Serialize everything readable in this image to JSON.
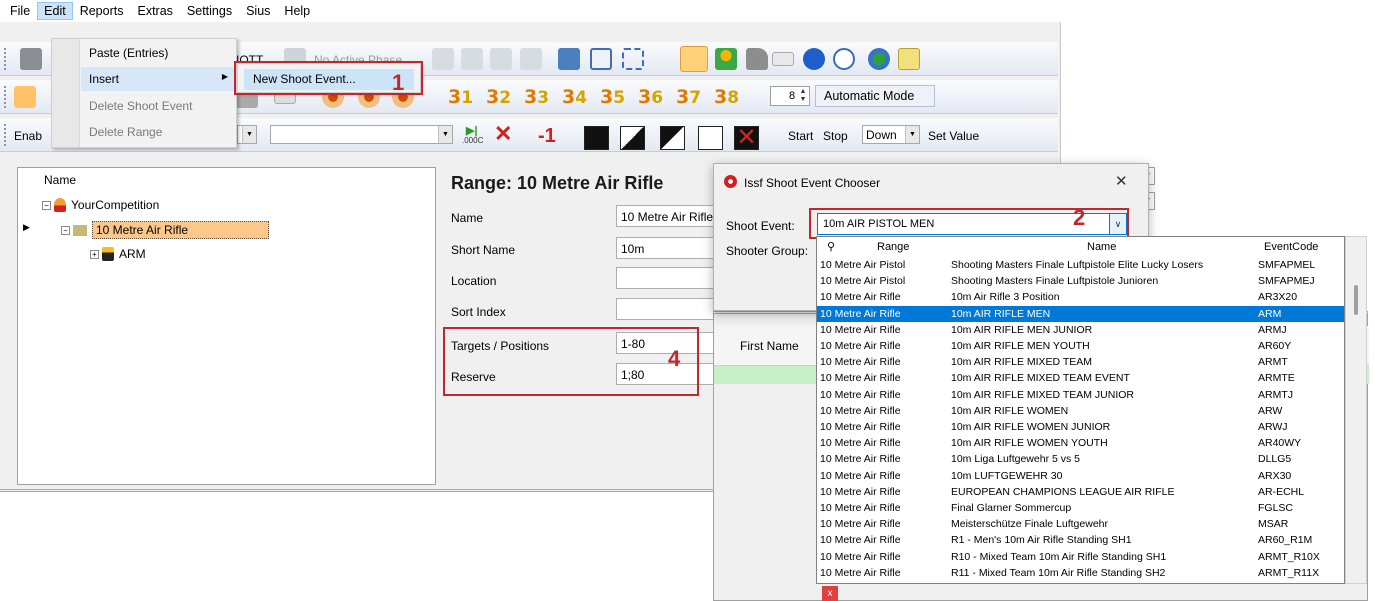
{
  "menubar": {
    "items": [
      "File",
      "Edit",
      "Reports",
      "Extras",
      "Settings",
      "Sius",
      "Help"
    ]
  },
  "edit_menu": {
    "items": [
      {
        "label": "Paste (Entries)",
        "disabled": false
      },
      {
        "label": "Insert",
        "disabled": false,
        "submenu": true
      },
      {
        "label": "Delete Shoot Event",
        "disabled": true
      },
      {
        "label": "Delete Range",
        "disabled": true
      }
    ],
    "submenu_item": "New Shoot Event..."
  },
  "toolbar1": {
    "partial_label": "IOTT",
    "phase_label": "No Active Phase"
  },
  "toolbar2": {
    "positions": [
      {
        "a": "3",
        "b": "1"
      },
      {
        "a": "3",
        "b": "2"
      },
      {
        "a": "3",
        "b": "3"
      },
      {
        "a": "3",
        "b": "4"
      },
      {
        "a": "3",
        "b": "5"
      },
      {
        "a": "3",
        "b": "6"
      },
      {
        "a": "3",
        "b": "7"
      },
      {
        "a": "3",
        "b": "8"
      }
    ],
    "spin_value": "8",
    "mode_button": "Automatic Mode"
  },
  "toolbar3": {
    "enable_label": "Enab",
    "minus_one": "-1",
    "start": "Start",
    "stop": "Stop",
    "direction": "Down",
    "set_value": "Set Value",
    "counter_label": ".000C"
  },
  "tree": {
    "header": "Name",
    "competition": "YourCompetition",
    "range": "10 Metre Air Rifle",
    "event": "ARM"
  },
  "detail": {
    "title": "Range: 10 Metre Air Rifle",
    "fields": [
      {
        "label": "Name",
        "value": "10 Metre Air Rifle"
      },
      {
        "label": "Short Name",
        "value": "10m"
      },
      {
        "label": "Location",
        "value": ""
      },
      {
        "label": "Sort Index",
        "value": ""
      },
      {
        "label": "Targets / Positions",
        "value": "1-80"
      },
      {
        "label": "Reserve",
        "value": "1;80"
      }
    ]
  },
  "callouts": {
    "one": "1",
    "two": "2",
    "four": "4"
  },
  "dialog": {
    "title": "Issf Shoot Event Chooser",
    "close": "✕",
    "shoot_event_label": "Shoot Event:",
    "shoot_event_value": "10m AIR PISTOL MEN",
    "shooter_group_label": "Shooter Group:"
  },
  "back_grid": {
    "first_name": "First Name"
  },
  "dropdown": {
    "headers": {
      "range": "Range",
      "name": "Name",
      "code": "EventCode"
    },
    "rows": [
      {
        "range": "10 Metre Air Pistol",
        "name": "Shooting Masters Finale Luftpistole Elite Lucky Losers",
        "code": "SMFAPMEL"
      },
      {
        "range": "10 Metre Air Pistol",
        "name": "Shooting Masters Finale Luftpistole Junioren",
        "code": "SMFAPMEJ"
      },
      {
        "range": "10 Metre Air Rifle",
        "name": "10m Air Rifle 3 Position",
        "code": "AR3X20"
      },
      {
        "range": "10 Metre Air Rifle",
        "name": "10m AIR RIFLE MEN",
        "code": "ARM"
      },
      {
        "range": "10 Metre Air Rifle",
        "name": "10m AIR RIFLE MEN JUNIOR",
        "code": "ARMJ"
      },
      {
        "range": "10 Metre Air Rifle",
        "name": "10m AIR RIFLE MEN YOUTH",
        "code": "AR60Y"
      },
      {
        "range": "10 Metre Air Rifle",
        "name": "10m AIR RIFLE MIXED TEAM",
        "code": "ARMT"
      },
      {
        "range": "10 Metre Air Rifle",
        "name": "10m AIR RIFLE MIXED TEAM EVENT",
        "code": "ARMTE"
      },
      {
        "range": "10 Metre Air Rifle",
        "name": "10m AIR RIFLE MIXED TEAM JUNIOR",
        "code": "ARMTJ"
      },
      {
        "range": "10 Metre Air Rifle",
        "name": "10m AIR RIFLE WOMEN",
        "code": "ARW"
      },
      {
        "range": "10 Metre Air Rifle",
        "name": "10m AIR RIFLE WOMEN JUNIOR",
        "code": "ARWJ"
      },
      {
        "range": "10 Metre Air Rifle",
        "name": "10m AIR RIFLE WOMEN YOUTH",
        "code": "AR40WY"
      },
      {
        "range": "10 Metre Air Rifle",
        "name": "10m Liga Luftgewehr 5 vs 5",
        "code": "DLLG5"
      },
      {
        "range": "10 Metre Air Rifle",
        "name": "10m LUFTGEWEHR 30",
        "code": "ARX30"
      },
      {
        "range": "10 Metre Air Rifle",
        "name": "EUROPEAN CHAMPIONS LEAGUE AIR RIFLE",
        "code": "AR-ECHL"
      },
      {
        "range": "10 Metre Air Rifle",
        "name": "Final Glarner Sommercup",
        "code": "FGLSC"
      },
      {
        "range": "10 Metre Air Rifle",
        "name": "Meisterschütze Finale Luftgewehr",
        "code": "MSAR"
      },
      {
        "range": "10 Metre Air Rifle",
        "name": "R1 - Men's 10m Air Rifle Standing SH1",
        "code": "AR60_R1M"
      },
      {
        "range": "10 Metre Air Rifle",
        "name": "R10 - Mixed Team 10m Air Rifle Standing SH1",
        "code": "ARMT_R10X"
      },
      {
        "range": "10 Metre Air Rifle",
        "name": "R11 - Mixed Team 10m Air Rifle Standing SH2",
        "code": "ARMT_R11X"
      }
    ],
    "selected_index": 3
  },
  "colors": {
    "callout_red": "#c0282d",
    "selection_blue": "#0078d7",
    "tree_selection": "#fbc88a"
  }
}
